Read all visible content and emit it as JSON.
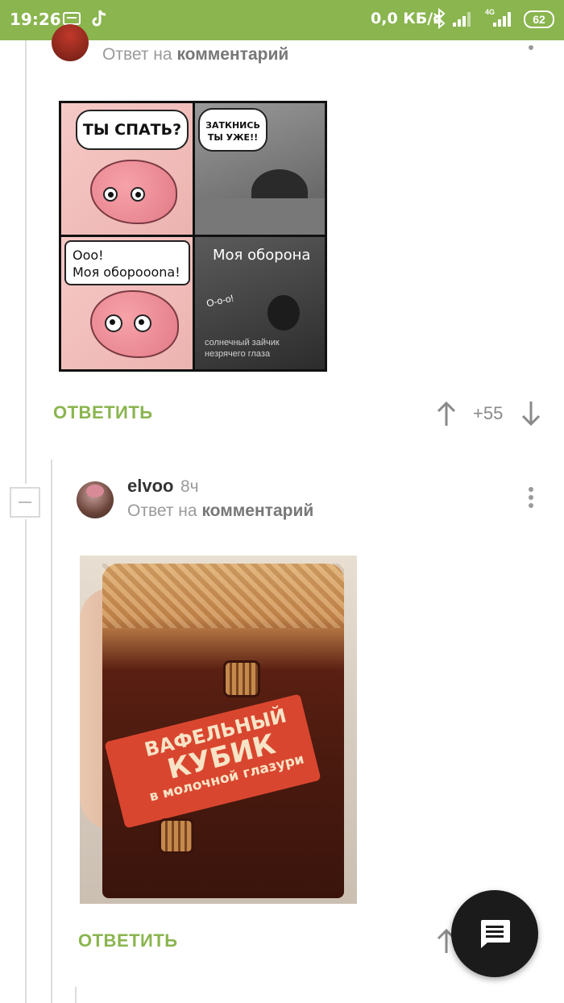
{
  "status_bar": {
    "time": "19:26",
    "speed": "0,0 КБ/с",
    "network": "4G",
    "battery": "62"
  },
  "comment1": {
    "reply_prefix": "Ответ на",
    "reply_target": "комментарий",
    "image": {
      "panel1_text": "ТЫ СПАТЬ?",
      "panel2_text_line1": "ЗАТКНИСЬ",
      "panel2_text_line2": "ТЫ УЖЕ!!",
      "panel3_text_line1": "Ооо!",
      "panel3_text_line2": "Моя обороооna!",
      "panel4_text": "Моя оборона",
      "panel4_small": "О-о-о!",
      "watermark_line1": "солнечный зайчик",
      "watermark_line2": "незрячего глаза"
    },
    "reply_label": "ОТВЕТИТЬ",
    "score": "+55"
  },
  "comment2": {
    "username": "elvoo",
    "time": "8ч",
    "reply_prefix": "Ответ на",
    "reply_target": "комментарий",
    "image": {
      "text_line1": "ВАФЕЛЬНЫЙ",
      "text_line2": "КУБИК",
      "text_line3": "в молочной глазури"
    },
    "reply_label": "ОТВЕТИТЬ"
  },
  "colors": {
    "accent": "#8ab54f",
    "fab": "#1b1b1b"
  },
  "icons": [
    "tiktok-icon",
    "bluetooth-icon",
    "signal-icon",
    "arrow-up-icon",
    "arrow-down-icon",
    "comment-icon"
  ]
}
